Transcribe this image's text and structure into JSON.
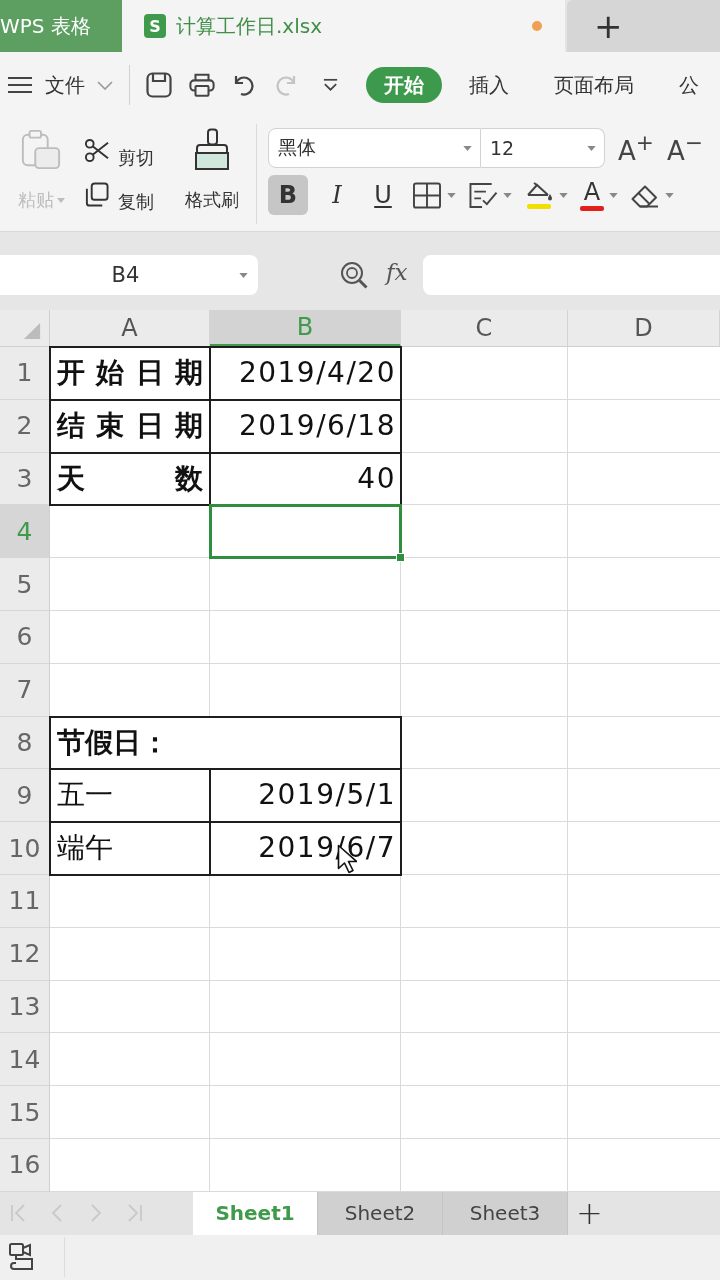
{
  "app_tab": {
    "label": "WPS 表格"
  },
  "document_tab": {
    "badge": "S",
    "title": "计算工作日.xlsx",
    "unsaved": true
  },
  "new_tab": {
    "label": "+"
  },
  "menu": {
    "file": "文件",
    "quick_access": [
      {
        "kind": "save",
        "disabled": false
      },
      {
        "kind": "print",
        "disabled": false
      },
      {
        "kind": "undo",
        "disabled": false
      },
      {
        "kind": "redo",
        "disabled": true
      },
      {
        "kind": "more",
        "disabled": false
      }
    ],
    "tabs": [
      {
        "label": "开始",
        "selected": true
      },
      {
        "label": "插入",
        "selected": false
      },
      {
        "label": "页面布局",
        "selected": false
      },
      {
        "label": "公",
        "selected": false
      }
    ]
  },
  "ribbon": {
    "clipboard": [
      {
        "kind": "paste",
        "label": "粘贴",
        "disabled": true
      },
      {
        "kind": "cut",
        "label": "剪切",
        "disabled": false
      },
      {
        "kind": "copy",
        "label": "复制",
        "disabled": false
      },
      {
        "kind": "format_painter",
        "label": "格式刷",
        "disabled": false
      }
    ],
    "font_name": "黑体",
    "font_size": "12",
    "size_buttons": [
      "A$^{+}$",
      "A$^{−}$"
    ],
    "format_buttons": [
      {
        "kind": "bold",
        "label": "B",
        "selected": true
      },
      {
        "kind": "italic",
        "label": "I",
        "selected": false
      },
      {
        "kind": "underline",
        "label": "U",
        "selected": false
      },
      {
        "kind": "borders"
      },
      {
        "kind": "conditional"
      },
      {
        "kind": "fill_color",
        "color": "#f0e000"
      },
      {
        "kind": "font_color",
        "label": "A",
        "color": "#e0201c"
      },
      {
        "kind": "clear"
      }
    ]
  },
  "formula_bar": {
    "name_box": "B4",
    "function_label": "fx"
  },
  "sheet": {
    "columns": [
      {
        "label": "A",
        "selected": false
      },
      {
        "label": "B",
        "selected": true
      },
      {
        "label": "C",
        "selected": false
      },
      {
        "label": "D",
        "selected": false
      }
    ],
    "rows": [
      {
        "label": "1",
        "selected": false,
        "a": {
          "kind": "distributed",
          "text": "开始日期",
          "bold": true,
          "bordered": true
        },
        "b": {
          "kind": "number",
          "text": "2019/4/20",
          "bold": false,
          "bordered": true
        }
      },
      {
        "label": "2",
        "selected": false,
        "a": {
          "kind": "distributed",
          "text": "结束日期",
          "bold": true,
          "bordered": true
        },
        "b": {
          "kind": "number",
          "text": "2019/6/18",
          "bold": false,
          "bordered": true
        }
      },
      {
        "label": "3",
        "selected": false,
        "a": {
          "kind": "distributed",
          "text": "天 数",
          "bold": true,
          "bordered": true
        },
        "b": {
          "kind": "number",
          "text": "40",
          "bold": false,
          "bordered": true
        }
      },
      {
        "label": "4",
        "selected": true,
        "b": {
          "kind": "text",
          "active": true
        }
      },
      {
        "label": "5",
        "selected": false
      },
      {
        "label": "6",
        "selected": false
      },
      {
        "label": "7",
        "selected": false
      },
      {
        "label": "8",
        "selected": false,
        "a": {
          "kind": "text",
          "text": "节假日：",
          "bold": true,
          "bordered": true,
          "merged": true
        }
      },
      {
        "label": "9",
        "selected": false,
        "a": {
          "kind": "text",
          "text": "五一",
          "bold": false,
          "bordered": true
        },
        "b": {
          "kind": "number",
          "text": "2019/5/1",
          "bold": false,
          "bordered": true
        }
      },
      {
        "label": "10",
        "selected": false,
        "a": {
          "kind": "text",
          "text": "端午",
          "bold": false,
          "bordered": true
        },
        "b": {
          "kind": "number",
          "text": "2019/6/7",
          "bold": false,
          "bordered": true,
          "pointer": true
        }
      },
      {
        "label": "11",
        "selected": false
      },
      {
        "label": "12",
        "selected": false
      },
      {
        "label": "13",
        "selected": false
      },
      {
        "label": "14",
        "selected": false
      },
      {
        "label": "15",
        "selected": false
      },
      {
        "label": "16",
        "selected": false
      }
    ]
  },
  "sheet_tabs": {
    "nav": [
      {
        "kind": "first",
        "disabled": true
      },
      {
        "kind": "prev",
        "disabled": true
      },
      {
        "kind": "next",
        "disabled": true
      },
      {
        "kind": "last",
        "disabled": true
      }
    ],
    "tabs": [
      {
        "label": "Sheet1",
        "selected": true
      },
      {
        "label": "Sheet2",
        "selected": false
      },
      {
        "label": "Sheet3",
        "selected": false
      }
    ],
    "add": "+"
  }
}
